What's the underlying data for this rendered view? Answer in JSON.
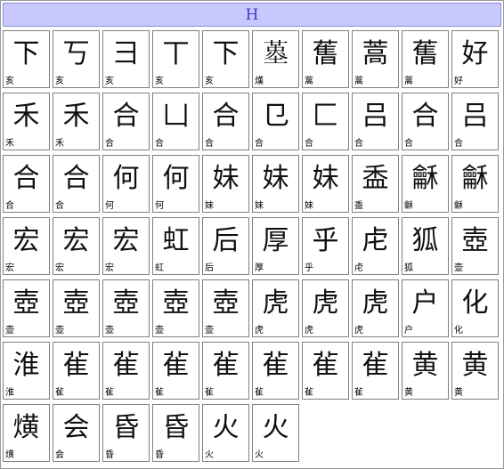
{
  "header": {
    "letter": "H"
  },
  "rows": [
    [
      {
        "glyph": "下",
        "label": "亥"
      },
      {
        "glyph": "丂",
        "label": "亥"
      },
      {
        "glyph": "彐",
        "label": "亥"
      },
      {
        "glyph": "丅",
        "label": "亥"
      },
      {
        "glyph": "下",
        "label": "亥"
      },
      {
        "glyph": "𡏳",
        "label": "熯"
      },
      {
        "glyph": "𦾔",
        "label": "蒿"
      },
      {
        "glyph": "蒿",
        "label": "蒿"
      },
      {
        "glyph": "𦾔",
        "label": "蒿"
      },
      {
        "glyph": "好",
        "label": "好"
      }
    ],
    [
      {
        "glyph": "禾",
        "label": "禾"
      },
      {
        "glyph": "禾",
        "label": "禾"
      },
      {
        "glyph": "合",
        "label": "合"
      },
      {
        "glyph": "凵",
        "label": "合"
      },
      {
        "glyph": "合",
        "label": "合"
      },
      {
        "glyph": "㔾",
        "label": "合"
      },
      {
        "glyph": "匚",
        "label": "合"
      },
      {
        "glyph": "吕",
        "label": "合"
      },
      {
        "glyph": "合",
        "label": "合"
      },
      {
        "glyph": "吕",
        "label": "合"
      }
    ],
    [
      {
        "glyph": "合",
        "label": "合"
      },
      {
        "glyph": "合",
        "label": "合"
      },
      {
        "glyph": "何",
        "label": "何"
      },
      {
        "glyph": "何",
        "label": "何"
      },
      {
        "glyph": "妹",
        "label": "妹"
      },
      {
        "glyph": "妹",
        "label": "妹"
      },
      {
        "glyph": "妹",
        "label": "妹"
      },
      {
        "glyph": "盉",
        "label": "盉"
      },
      {
        "glyph": "龢",
        "label": "龢"
      },
      {
        "glyph": "龢",
        "label": "龢"
      }
    ],
    [
      {
        "glyph": "宏",
        "label": "宏"
      },
      {
        "glyph": "宏",
        "label": "宏"
      },
      {
        "glyph": "宏",
        "label": "宏"
      },
      {
        "glyph": "虹",
        "label": "虹"
      },
      {
        "glyph": "后",
        "label": "后"
      },
      {
        "glyph": "厚",
        "label": "厚"
      },
      {
        "glyph": "乎",
        "label": "乎"
      },
      {
        "glyph": "虍",
        "label": "虍"
      },
      {
        "glyph": "狐",
        "label": "狐"
      },
      {
        "glyph": "壺",
        "label": "壶"
      }
    ],
    [
      {
        "glyph": "壺",
        "label": "壶"
      },
      {
        "glyph": "壺",
        "label": "壶"
      },
      {
        "glyph": "壺",
        "label": "壶"
      },
      {
        "glyph": "壺",
        "label": "壶"
      },
      {
        "glyph": "壺",
        "label": "壶"
      },
      {
        "glyph": "虎",
        "label": "虎"
      },
      {
        "glyph": "虎",
        "label": "虎"
      },
      {
        "glyph": "虎",
        "label": "虎"
      },
      {
        "glyph": "户",
        "label": "户"
      },
      {
        "glyph": "化",
        "label": "化"
      }
    ],
    [
      {
        "glyph": "淮",
        "label": "淮"
      },
      {
        "glyph": "雈",
        "label": "雈"
      },
      {
        "glyph": "雈",
        "label": "雈"
      },
      {
        "glyph": "雈",
        "label": "雈"
      },
      {
        "glyph": "雈",
        "label": "雈"
      },
      {
        "glyph": "雈",
        "label": "雈"
      },
      {
        "glyph": "雈",
        "label": "雈"
      },
      {
        "glyph": "雈",
        "label": "雈"
      },
      {
        "glyph": "黄",
        "label": "黄"
      },
      {
        "glyph": "黄",
        "label": "黄"
      }
    ],
    [
      {
        "glyph": "熿",
        "label": "熿"
      },
      {
        "glyph": "会",
        "label": "会"
      },
      {
        "glyph": "昏",
        "label": "昏"
      },
      {
        "glyph": "昏",
        "label": "昏"
      },
      {
        "glyph": "火",
        "label": "火"
      },
      {
        "glyph": "火",
        "label": "火"
      }
    ]
  ]
}
